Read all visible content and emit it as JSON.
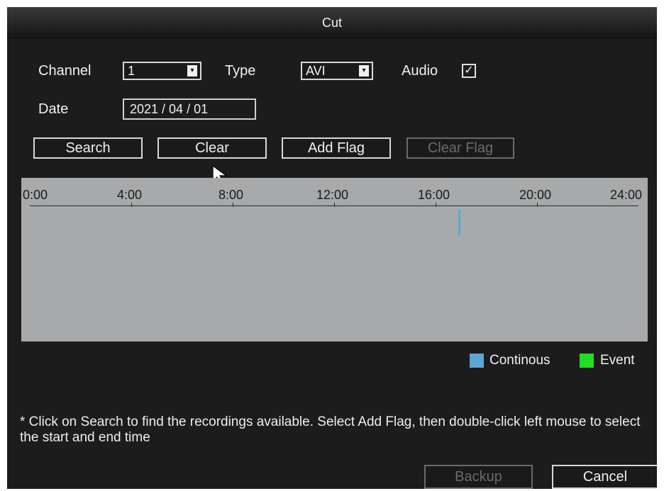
{
  "window": {
    "title": "Cut"
  },
  "filters": {
    "channel_label": "Channel",
    "channel_value": "1",
    "type_label": "Type",
    "type_value": "AVI",
    "audio_label": "Audio",
    "audio_checked": true,
    "date_label": "Date",
    "date_value": "2021 / 04 / 01"
  },
  "actions": {
    "search": "Search",
    "clear": "Clear",
    "add_flag": "Add Flag",
    "clear_flag": "Clear Flag"
  },
  "timeline": {
    "ticks": [
      "0:00",
      "4:00",
      "8:00",
      "12:00",
      "16:00",
      "20:00",
      "24:00"
    ],
    "recordings": [
      {
        "type": "Continous",
        "hour": 16.9
      }
    ]
  },
  "legend": [
    {
      "label": "Continous",
      "color": "#5aa7d6"
    },
    {
      "label": "Event",
      "color": "#22dd22"
    }
  ],
  "note": "* Click on Search to find the recordings available. Select Add Flag, then double-click left mouse to select the start and end time",
  "footer": {
    "backup": "Backup",
    "cancel": "Cancel"
  },
  "icons": {
    "dropdown": "chevron-down-icon",
    "check": "check-icon",
    "cursor": "mouse-pointer-icon"
  }
}
